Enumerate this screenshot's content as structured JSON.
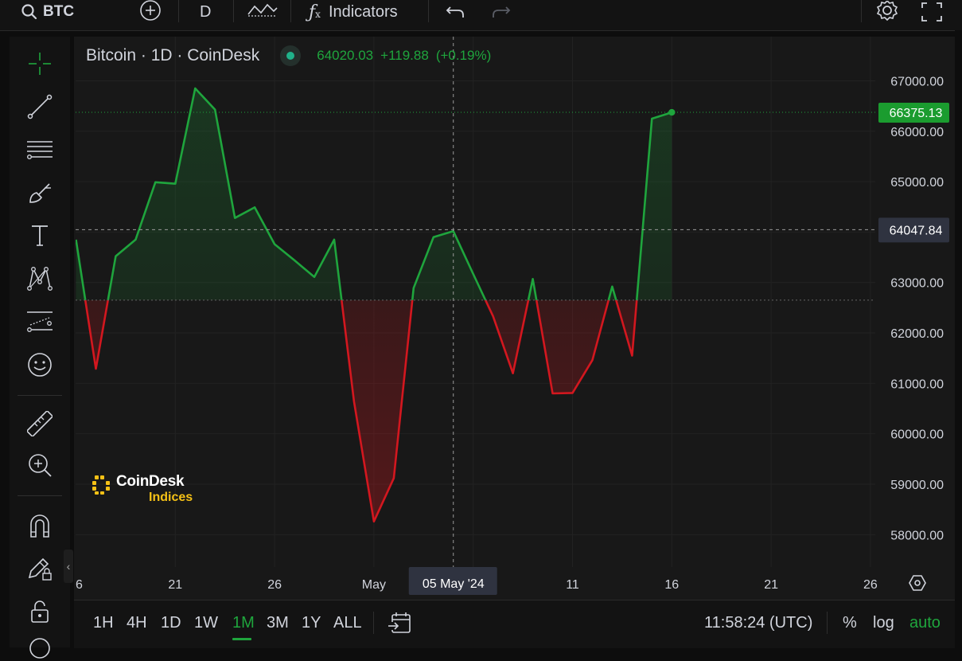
{
  "toolbar": {
    "symbol": "BTC",
    "interval": "D",
    "indicators_label": "Indicators"
  },
  "legend": {
    "name": "Bitcoin · 1D · CoinDesk",
    "price": "64020.03",
    "change": "+119.88",
    "change_pct": "(+0.19%)"
  },
  "watermark": {
    "line1": "CoinDesk",
    "line2": "Indices"
  },
  "colors": {
    "up": "#1fa53d",
    "down": "#d3171f",
    "panel": "#181818",
    "label_current": "#1b9c2f",
    "label_cursor": "#2f3340"
  },
  "chart_data": {
    "type": "area",
    "style": "baseline",
    "baseline": 62650,
    "x": [
      "2024-04-16",
      "2024-04-17",
      "2024-04-18",
      "2024-04-19",
      "2024-04-20",
      "2024-04-21",
      "2024-04-22",
      "2024-04-23",
      "2024-04-24",
      "2024-04-25",
      "2024-04-26",
      "2024-04-27",
      "2024-04-28",
      "2024-04-29",
      "2024-04-30",
      "2024-05-01",
      "2024-05-02",
      "2024-05-03",
      "2024-05-04",
      "2024-05-05",
      "2024-05-06",
      "2024-05-07",
      "2024-05-08",
      "2024-05-09",
      "2024-05-10",
      "2024-05-11",
      "2024-05-12",
      "2024-05-13",
      "2024-05-14",
      "2024-05-15",
      "2024-05-16"
    ],
    "y": [
      63850,
      61290,
      63520,
      63850,
      64990,
      64960,
      66850,
      66430,
      64280,
      64490,
      63760,
      63440,
      63110,
      63850,
      60640,
      58260,
      59120,
      62890,
      63900,
      64020,
      63170,
      62330,
      61200,
      63070,
      60800,
      60810,
      61460,
      62920,
      61550,
      66250,
      66375.13
    ],
    "x_ticks": [
      "6",
      "21",
      "26",
      "May",
      "11",
      "16",
      "21",
      "26"
    ],
    "y_ticks": [
      "67000.00",
      "66000.00",
      "65000.00",
      "63000.00",
      "62000.00",
      "61000.00",
      "60000.00",
      "59000.00",
      "58000.00"
    ],
    "ylim": [
      57450,
      67500
    ],
    "grid": true,
    "current_price": "66375.13",
    "crosshair": {
      "date_label": "05 May '24",
      "price": 64047.84,
      "price_label": "64047.84"
    }
  },
  "bottom": {
    "ranges": [
      "1H",
      "4H",
      "1D",
      "1W",
      "1M",
      "3M",
      "1Y",
      "ALL"
    ],
    "active_range": "1M",
    "time": "11:58:24 (UTC)",
    "percent": "%",
    "log": "log",
    "auto": "auto"
  }
}
